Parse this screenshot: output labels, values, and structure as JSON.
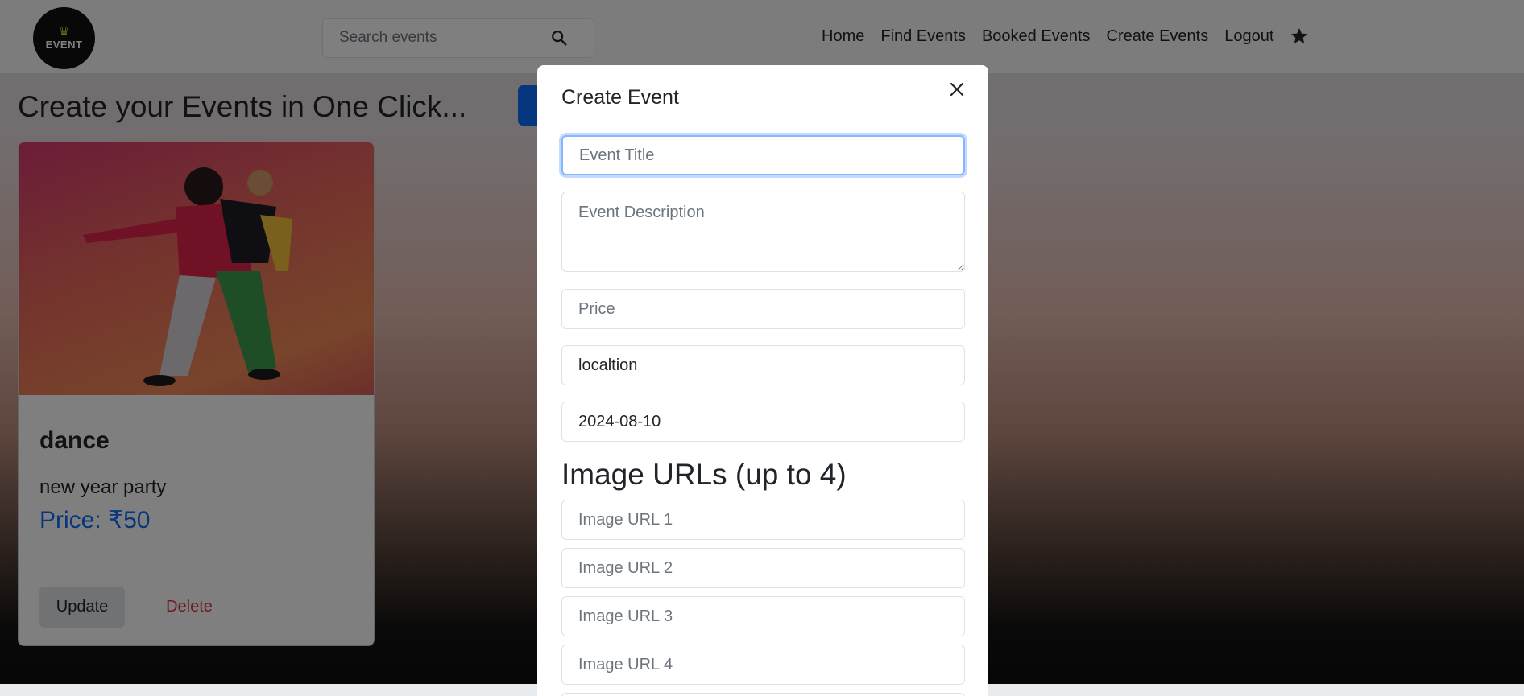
{
  "navbar": {
    "logo_text": "EVENT",
    "search_placeholder": "Search events",
    "links": [
      "Home",
      "Find Events",
      "Booked Events",
      "Create Events",
      "Logout"
    ]
  },
  "main": {
    "heading": "Create your Events in One Click...",
    "card": {
      "title": "dance",
      "description": "new year party",
      "price": "Price: ₹50",
      "update_label": "Update",
      "delete_label": "Delete"
    }
  },
  "modal": {
    "title": "Create Event",
    "fields": {
      "title_placeholder": "Event Title",
      "description_placeholder": "Event Description",
      "price_placeholder": "Price",
      "location_value": "localtion",
      "date_value": "2024-08-10"
    },
    "image_heading": "Image URLs (up to 4)",
    "image_placeholders": [
      "Image URL 1",
      "Image URL 2",
      "Image URL 3",
      "Image URL 4"
    ]
  },
  "colors": {
    "accent": "#0d6efd",
    "danger": "#dc3545",
    "focus_ring": "#86b7fe"
  },
  "icons": [
    "search-icon",
    "star-icon",
    "close-icon",
    "crown-icon"
  ]
}
